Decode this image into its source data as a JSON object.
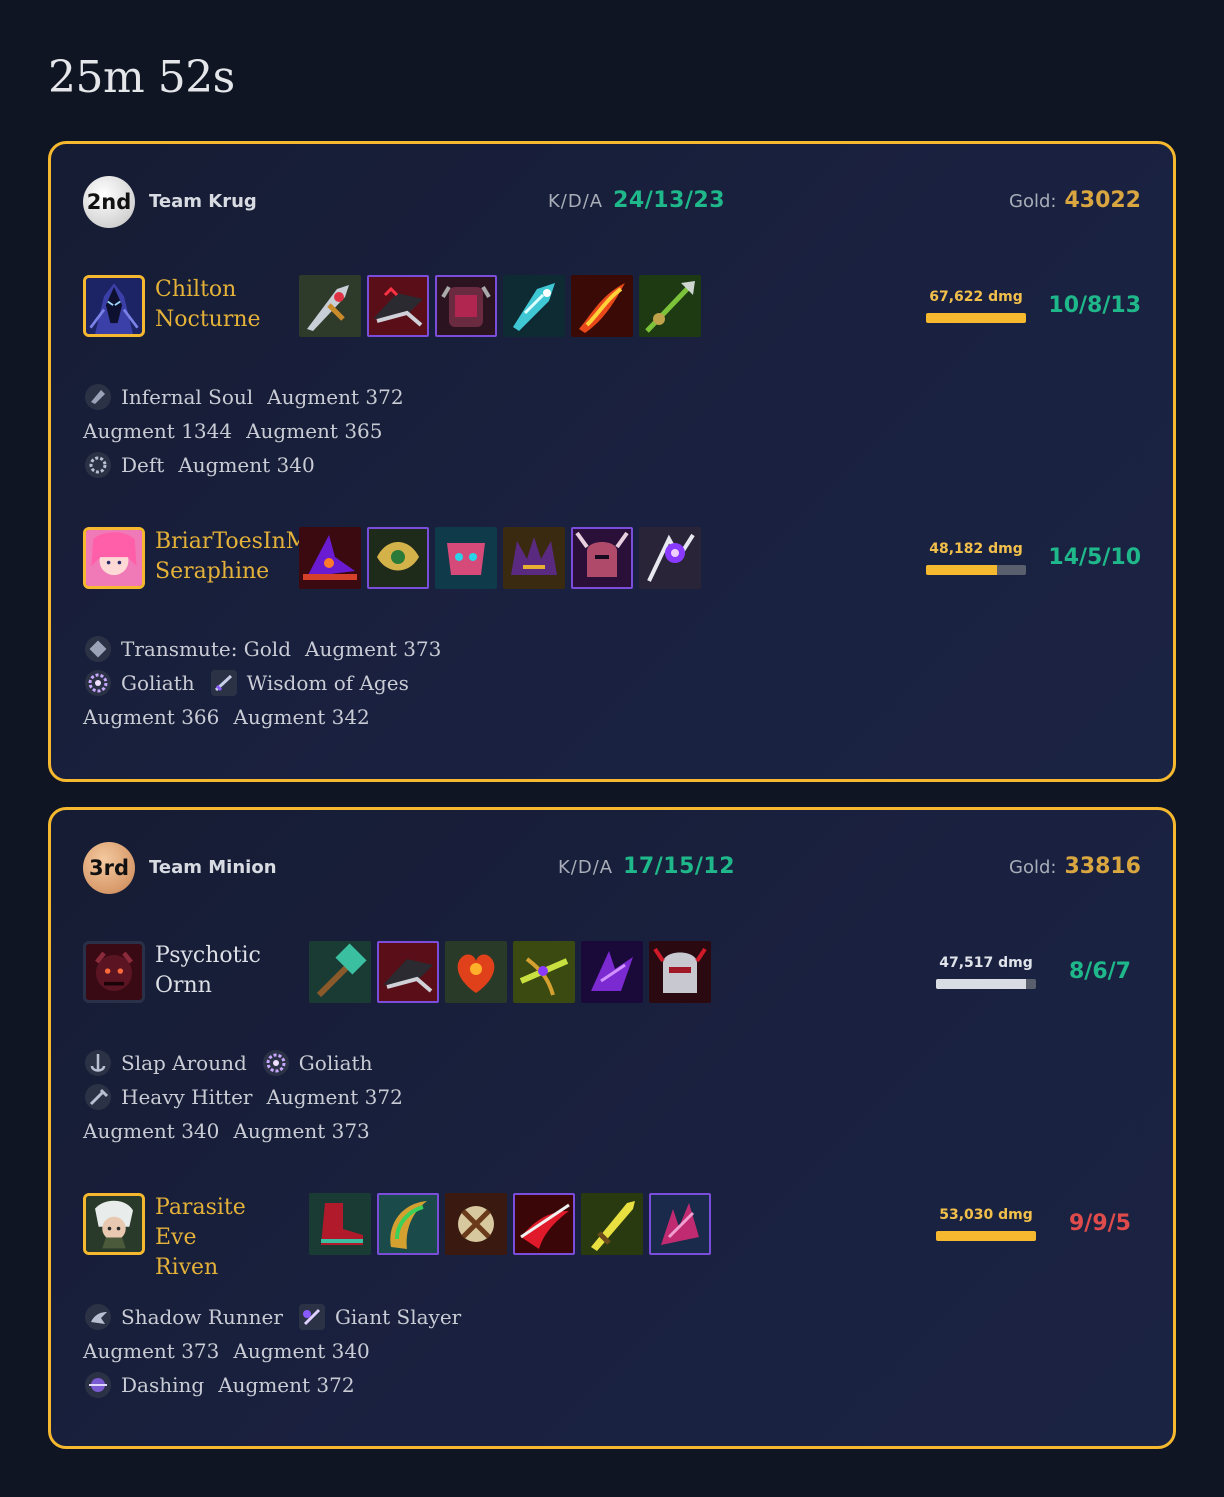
{
  "game": {
    "duration": "25m 52s"
  },
  "colors": {
    "accent_gold": "#f5b82e",
    "kda_green": "#1fb88a",
    "kda_red": "#e04b4b",
    "gold_text": "#d9a640"
  },
  "teams": [
    {
      "rank": "2nd",
      "name": "Team Krug",
      "kda_label": "K/D/A",
      "kda": "24/13/23",
      "gold_label": "Gold:",
      "gold": "43022",
      "players": [
        {
          "name_line1": "Chilton",
          "name_line2": "Nocturne",
          "champion_icon": "nocturne-portrait",
          "damage": "67,622 dmg",
          "damage_fraction": 1.0,
          "kda": "10/8/13",
          "items": [
            "dagger-item-icon",
            "serrated-blade-item-icon",
            "armor-item-icon",
            "spectral-blade-item-icon",
            "flame-blade-item-icon",
            "spear-item-icon"
          ],
          "augment_lines": [
            [
              {
                "icon": "infernal-soul-icon",
                "label": "Infernal Soul"
              },
              {
                "icon": "",
                "label": "Augment 372"
              }
            ],
            [
              {
                "icon": "",
                "label": "Augment 1344"
              },
              {
                "icon": "",
                "label": "Augment 365"
              }
            ],
            [
              {
                "icon": "deft-icon",
                "label": "Deft"
              },
              {
                "icon": "",
                "label": "Augment 340"
              }
            ]
          ]
        },
        {
          "name_line1": "BriarToesInMouth",
          "name_line2": "Seraphine",
          "champion_icon": "seraphine-portrait",
          "damage": "48,182 dmg",
          "damage_fraction": 0.71,
          "kda": "14/5/10",
          "items": [
            "witch-hat-item-icon",
            "golden-crest-item-icon",
            "mask-item-icon",
            "dark-crown-item-icon",
            "horned-helm-item-icon",
            "void-orb-item-icon"
          ],
          "augment_lines": [
            [
              {
                "icon": "transmute-gold-icon",
                "label": "Transmute: Gold"
              },
              {
                "icon": "",
                "label": "Augment 373"
              }
            ],
            [
              {
                "icon": "goliath-icon",
                "label": "Goliath"
              },
              {
                "icon": "wisdom-of-ages-icon",
                "label": "Wisdom of Ages"
              }
            ],
            [
              {
                "icon": "",
                "label": "Augment 366"
              },
              {
                "icon": "",
                "label": "Augment 342"
              }
            ]
          ]
        }
      ]
    },
    {
      "rank": "3rd",
      "name": "Team Minion",
      "kda_label": "K/D/A",
      "kda": "17/15/12",
      "gold_label": "Gold:",
      "gold": "33816",
      "players": [
        {
          "name_line1": "Psychotic",
          "name_line2": "Ornn",
          "champion_icon": "ornn-portrait",
          "damage": "47,517 dmg",
          "damage_fraction": 0.9,
          "kda": "8/6/7",
          "items": [
            "hammer-item-icon",
            "serrated-blade-item-icon",
            "heart-item-icon",
            "crossbow-item-icon",
            "void-claw-item-icon",
            "helm-item-icon"
          ],
          "augment_lines": [
            [
              {
                "icon": "slap-around-icon",
                "label": "Slap Around"
              },
              {
                "icon": "goliath-icon",
                "label": "Goliath"
              }
            ],
            [
              {
                "icon": "heavy-hitter-icon",
                "label": "Heavy Hitter"
              },
              {
                "icon": "",
                "label": "Augment 372"
              }
            ],
            [
              {
                "icon": "",
                "label": "Augment 340"
              },
              {
                "icon": "",
                "label": "Augment 373"
              }
            ]
          ]
        },
        {
          "name_line1": "Parasite",
          "name_line2": "Eve",
          "name_line3": "Riven",
          "champion_icon": "riven-portrait",
          "damage": "53,030 dmg",
          "damage_fraction": 1.0,
          "kda": "9/9/5",
          "items": [
            "boots-item-icon",
            "green-glaive-item-icon",
            "bone-crest-item-icon",
            "red-scythe-item-icon",
            "yellow-sword-item-icon",
            "pink-claw-item-icon"
          ],
          "augment_lines": [
            [
              {
                "icon": "shadow-runner-icon",
                "label": "Shadow Runner"
              },
              {
                "icon": "giant-slayer-icon",
                "label": "Giant Slayer"
              }
            ],
            [
              {
                "icon": "",
                "label": "Augment 373"
              },
              {
                "icon": "",
                "label": "Augment 340"
              }
            ],
            [
              {
                "icon": "dashing-icon",
                "label": "Dashing"
              },
              {
                "icon": "",
                "label": "Augment 372"
              }
            ]
          ]
        }
      ]
    }
  ]
}
